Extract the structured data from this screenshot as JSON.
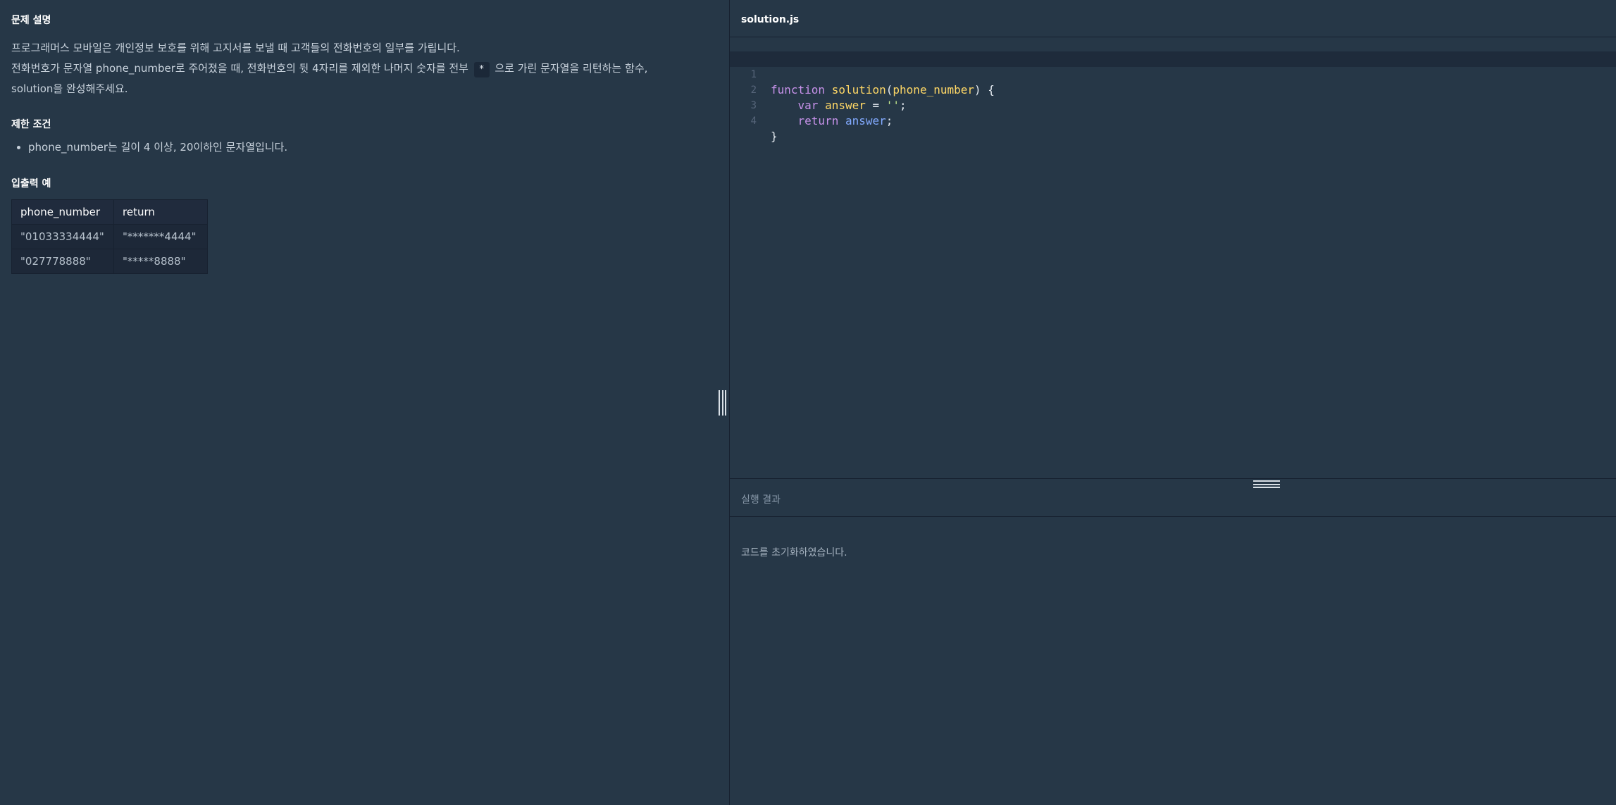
{
  "problem": {
    "section_description_title": "문제 설명",
    "description_line1": "프로그래머스 모바일은 개인정보 보호를 위해 고지서를 보낼 때 고객들의 전화번호의 일부를 가립니다.",
    "description_line2_before": "전화번호가 문자열 phone_number로 주어졌을 때, 전화번호의 뒷 4자리를 제외한 나머지 숫자를 전부",
    "description_code": "*",
    "description_line2_after": "으로 가린 문자열을 리턴하는 함수,",
    "description_line3": "solution을 완성해주세요.",
    "section_constraints_title": "제한 조건",
    "constraints": [
      "phone_number는 길이 4 이상, 20이하인 문자열입니다."
    ],
    "section_examples_title": "입출력 예",
    "table": {
      "headers": [
        "phone_number",
        "return"
      ],
      "rows": [
        [
          "\"01033334444\"",
          "\"*******4444\""
        ],
        [
          "\"027778888\"",
          "\"*****8888\""
        ]
      ]
    }
  },
  "editor": {
    "file_tab": "solution.js",
    "line_numbers": [
      "1",
      "2",
      "3",
      "4"
    ]
  },
  "result": {
    "title": "실행 결과",
    "message": "코드를  초기화하였습니다."
  },
  "colors": {
    "background": "#263747",
    "keyword": "#c792ea",
    "function_name": "#ffd866",
    "string": "#c3e88d",
    "identifier": "#82aaff"
  }
}
